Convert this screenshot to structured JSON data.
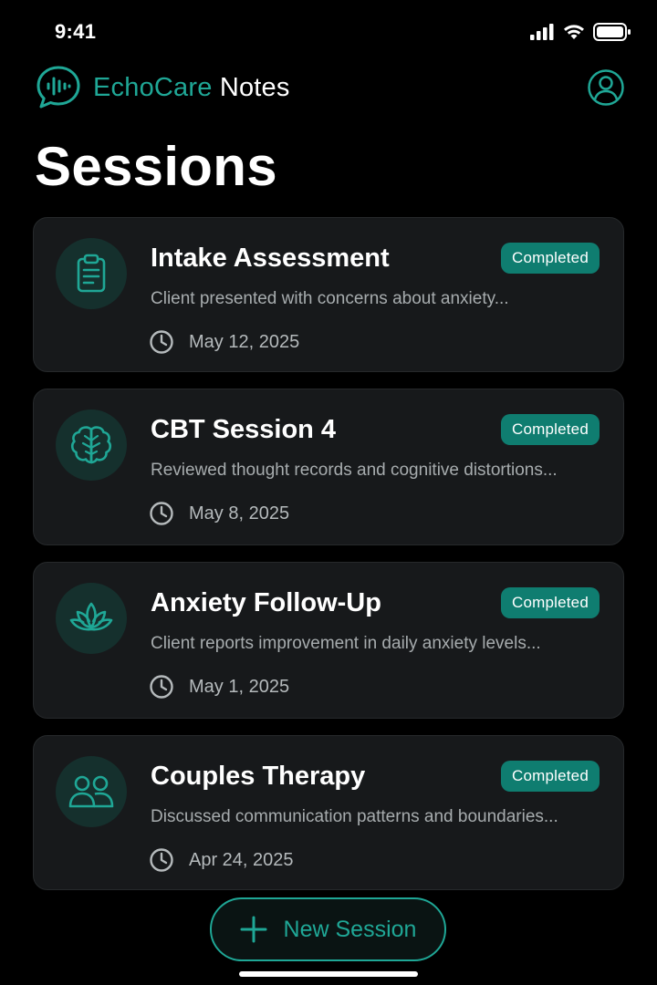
{
  "status_bar": {
    "time": "9:41"
  },
  "header": {
    "brand": "EchoCare",
    "suffix": " Notes"
  },
  "page": {
    "title": "Sessions"
  },
  "sessions": [
    {
      "title": "Intake Assessment",
      "status": "Completed",
      "summary": "Client presented with concerns about anxiety...",
      "date": "May 12, 2025",
      "icon": "clipboard-icon"
    },
    {
      "title": "CBT Session 4",
      "status": "Completed",
      "summary": "Reviewed thought records and cognitive distortions...",
      "date": "May 8, 2025",
      "icon": "brain-icon"
    },
    {
      "title": "Anxiety Follow-Up",
      "status": "Completed",
      "summary": "Client reports improvement in daily anxiety levels...",
      "date": "May 1, 2025",
      "icon": "lotus-icon"
    },
    {
      "title": "Couples Therapy",
      "status": "Completed",
      "summary": "Discussed communication patterns and boundaries...",
      "date": "Apr 24, 2025",
      "icon": "users-icon"
    }
  ],
  "actions": {
    "new_session": "New Session"
  },
  "colors": {
    "accent": "#1fa796",
    "badge": "#0f7d70",
    "card": "#17191b",
    "background": "#000000"
  }
}
